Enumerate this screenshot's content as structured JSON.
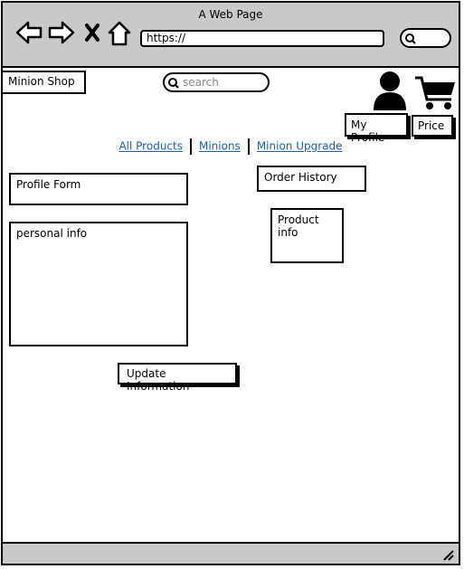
{
  "window": {
    "title": "A Web Page",
    "url": "https://"
  },
  "header": {
    "brand": "Minion Shop",
    "search_placeholder": "search",
    "profile_button": "My Profile",
    "price_button": "Price"
  },
  "nav": {
    "links": [
      "All Products",
      "Minions",
      "Minion Upgrade"
    ]
  },
  "main": {
    "profile_form_label": "Profile Form",
    "personal_info_label": "personal info",
    "update_button": "Update Information",
    "order_history_label": "Order History",
    "product_info_label": "Product info"
  },
  "icons": {
    "back": "arrow-left-icon",
    "forward": "arrow-right-icon",
    "close": "close-icon",
    "home": "home-icon",
    "search": "search-icon",
    "user": "user-icon",
    "cart": "cart-icon",
    "resize": "resize-grip-icon"
  }
}
